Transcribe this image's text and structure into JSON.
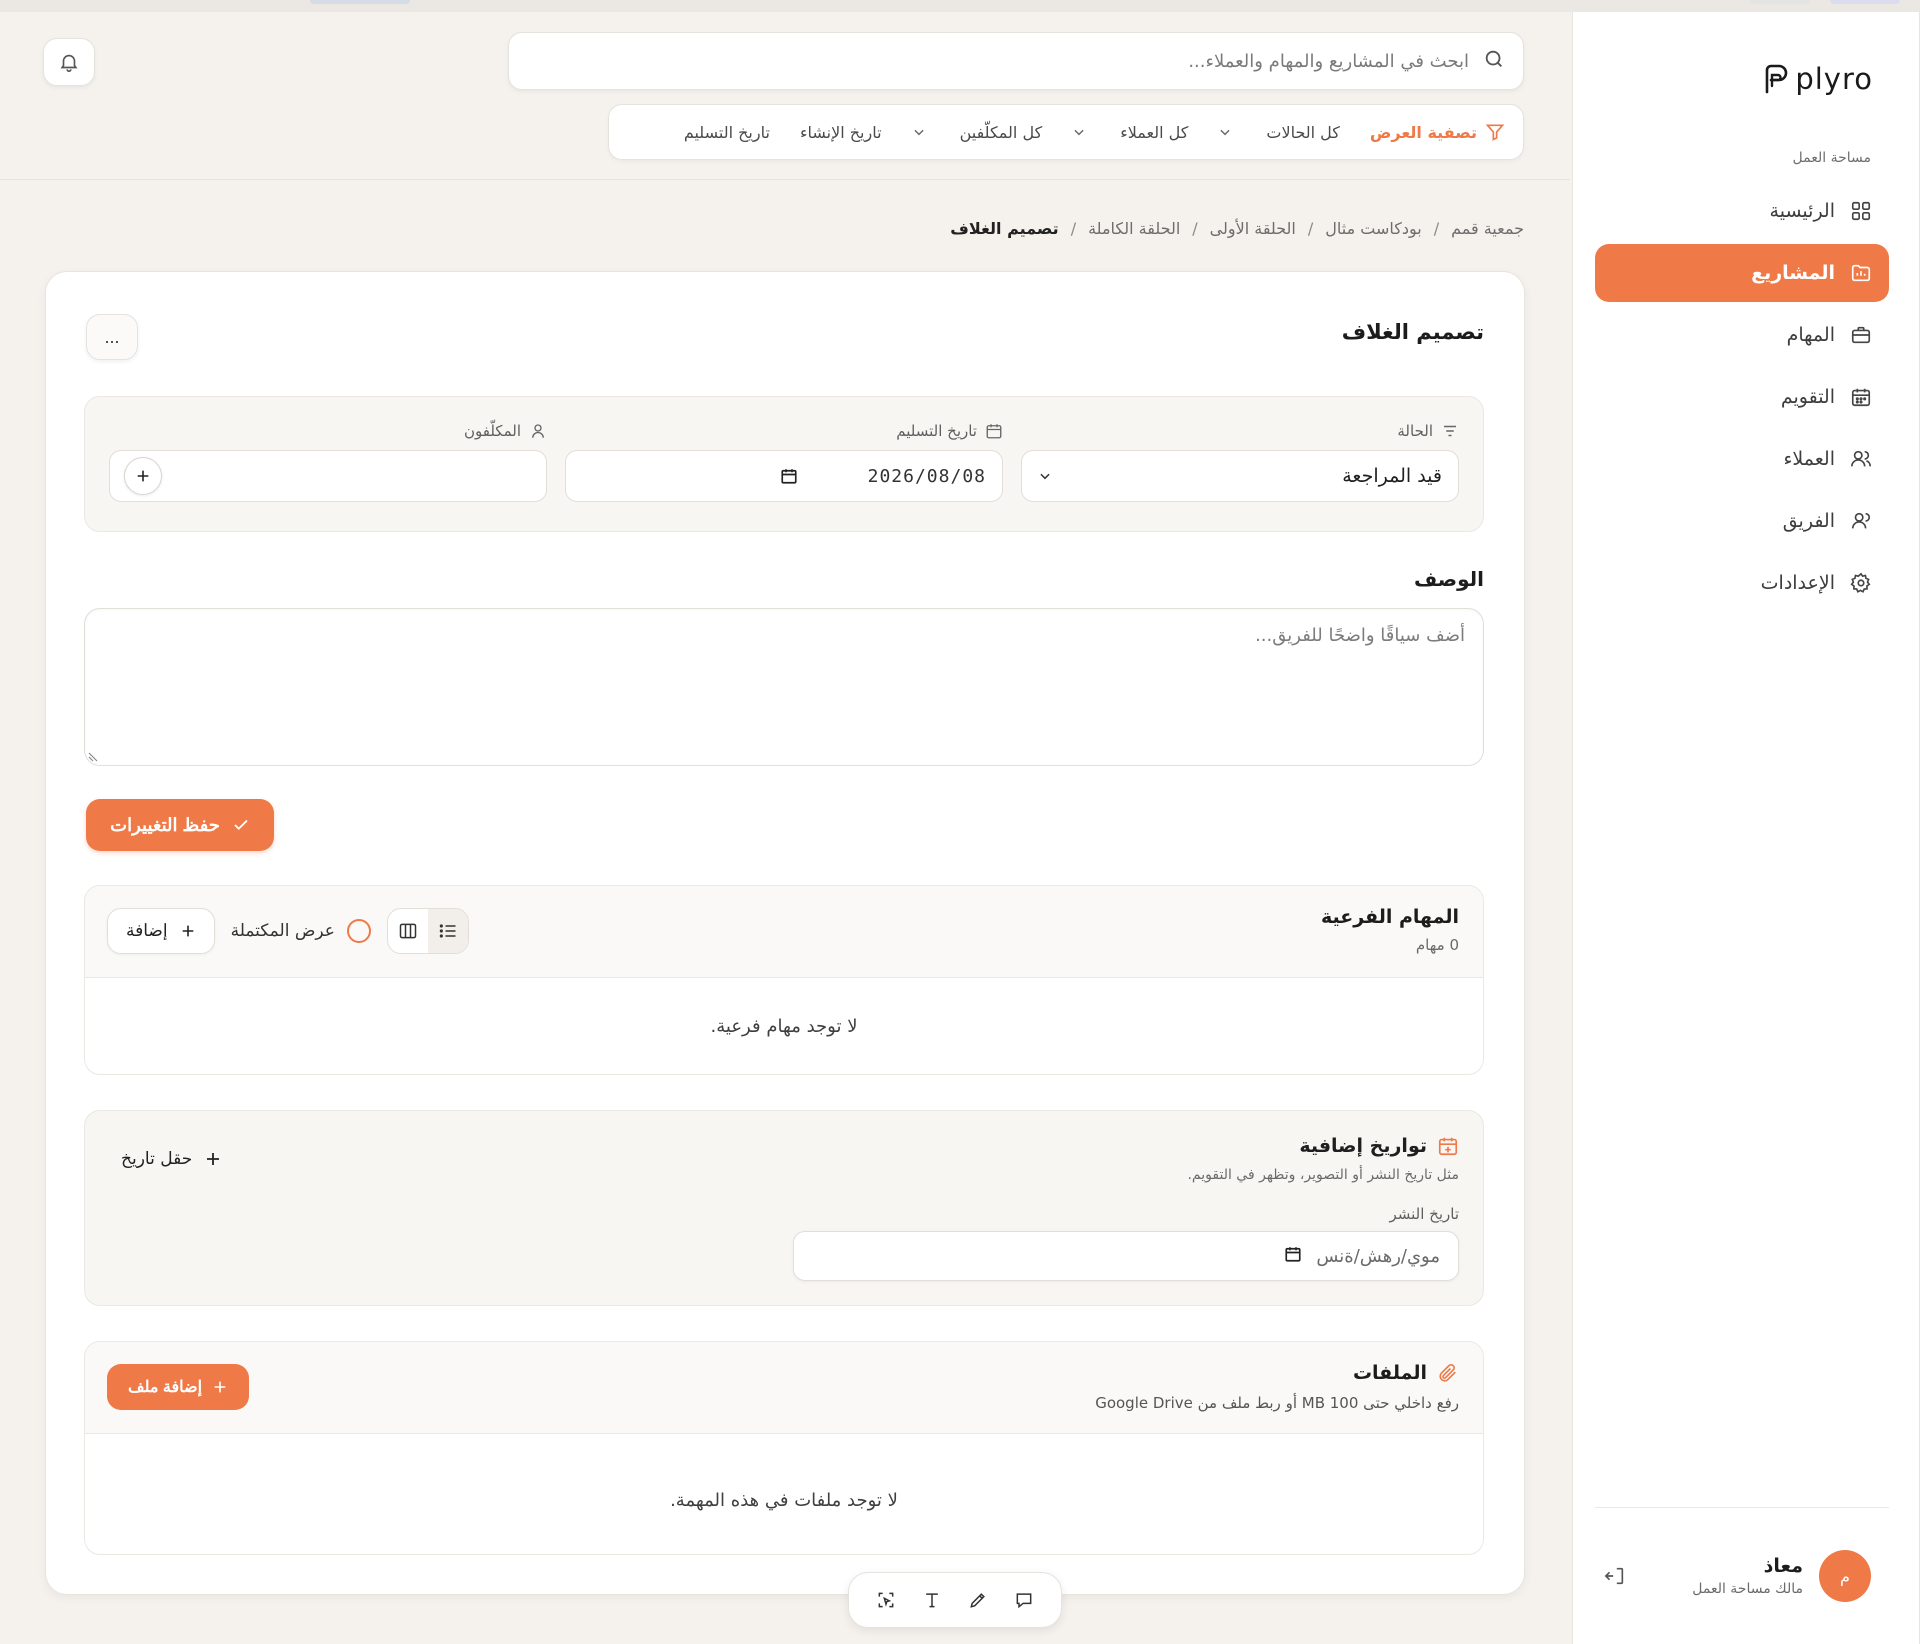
{
  "brand": {
    "name": "plyro",
    "accent": "#ef7a47"
  },
  "sidebar": {
    "section_label": "مساحة العمل",
    "items": [
      {
        "label": "الرئيسية",
        "icon": "dashboard-icon",
        "active": false
      },
      {
        "label": "المشاريع",
        "icon": "folder-icon",
        "active": true
      },
      {
        "label": "المهام",
        "icon": "briefcase-icon",
        "active": false
      },
      {
        "label": "التقويم",
        "icon": "calendar-icon",
        "active": false
      },
      {
        "label": "العملاء",
        "icon": "users-icon",
        "active": false
      },
      {
        "label": "الفريق",
        "icon": "team-icon",
        "active": false
      },
      {
        "label": "الإعدادات",
        "icon": "gear-icon",
        "active": false
      }
    ],
    "user": {
      "initial": "م",
      "name": "معاذ",
      "role": "مالك مساحة العمل"
    }
  },
  "header": {
    "search_placeholder": "ابحث في المشاريع والمهام والعملاء...",
    "filters": {
      "label": "تصفية العرض",
      "status": "كل الحالات",
      "clients": "كل العملاء",
      "assignees": "كل المكلّفين",
      "created": "تاريخ الإنشاء",
      "delivery": "تاريخ التسليم"
    }
  },
  "breadcrumb": [
    "جمعية قمم",
    "بودكاست مثال",
    "الحلقة الأولى",
    "الحلقة الكاملة",
    "تصميم الغلاف"
  ],
  "task": {
    "title": "تصميم الغلاف",
    "more_label": "...",
    "fields": {
      "status_label": "الحالة",
      "status_value": "قيد المراجعة",
      "due_label": "تاريخ التسليم",
      "due_value": "2026/08/08",
      "assignees_label": "المكلّفون"
    },
    "description_label": "الوصف",
    "description_placeholder": "أضف سياقًا واضحًا للفريق...",
    "save_label": "حفظ التغييرات"
  },
  "subtasks": {
    "title": "المهام الفرعية",
    "count": "0 مهام",
    "show_completed": "عرض المكتملة",
    "add_label": "إضافة",
    "empty": "لا توجد مهام فرعية."
  },
  "extra_dates": {
    "title": "تواريخ إضافية",
    "subtitle": "مثل تاريخ النشر أو التصوير، وتظهر في التقويم.",
    "field_label": "تاريخ النشر",
    "field_placeholder": "موي/رهش/ةنس",
    "add_field": "حقل تاريخ"
  },
  "files": {
    "title": "الملفات",
    "subtitle": "رفع داخلي حتى 100 MB أو ربط ملف من Google Drive",
    "add_label": "إضافة ملف",
    "empty": "لا توجد ملفات في هذه المهمة."
  }
}
